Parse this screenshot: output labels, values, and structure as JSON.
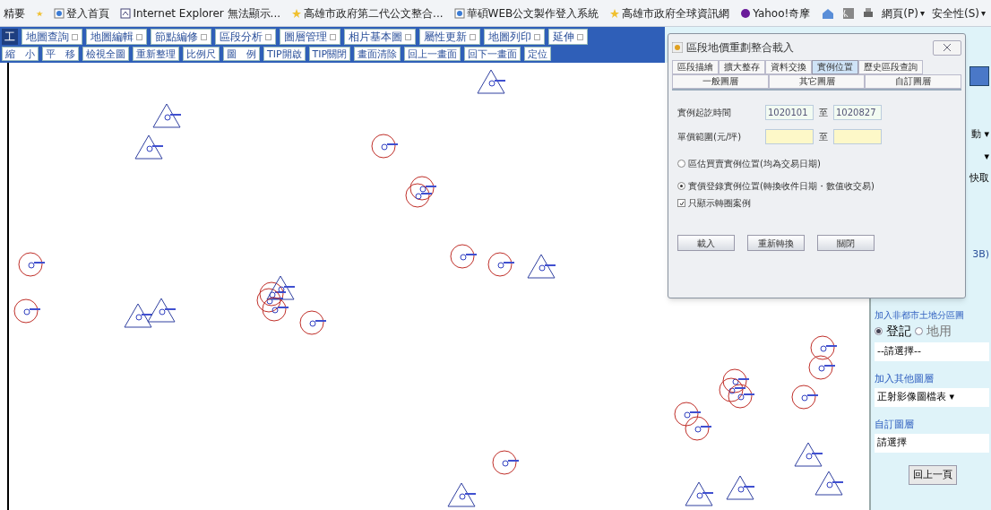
{
  "favorites_bar": {
    "items": [
      {
        "label": "精要",
        "kind": "text"
      },
      {
        "label": "登入首頁",
        "kind": "page"
      },
      {
        "label": "Internet Explorer 無法顯示...",
        "kind": "error"
      },
      {
        "label": "高雄市政府第二代公文整合...",
        "kind": "star"
      },
      {
        "label": "華碩WEB公文製作登入系統",
        "kind": "page"
      },
      {
        "label": "高雄市政府全球資訊網",
        "kind": "star"
      },
      {
        "label": "Yahoo!奇摩",
        "kind": "yahoo"
      }
    ],
    "commands": [
      {
        "label": "網頁(P)",
        "caret": "▾"
      },
      {
        "label": "安全性(S)",
        "caret": "▾"
      }
    ]
  },
  "menu_bar": {
    "title": "工",
    "items": [
      "地圖查詢",
      "地圖編輯",
      "節點編修",
      "區段分析",
      "圖層管理",
      "相片基本圖",
      "屬性更新",
      "地圖列印",
      "延伸"
    ]
  },
  "tool_bar": {
    "items": [
      "縮　小",
      "平　移",
      "檢視全圖",
      "重新整理",
      "比例尺",
      "圖　例",
      "TIP開啟",
      "TIP關閉",
      "畫面清除",
      "回上一畫面",
      "回下一畫面",
      "定位"
    ]
  },
  "dialog": {
    "title": "區段地價重劃整合載入",
    "tabs": [
      {
        "label": "區段描繪",
        "selected": false
      },
      {
        "label": "擴大整存",
        "selected": false
      },
      {
        "label": "資料交換",
        "selected": false
      },
      {
        "label": "實例位置",
        "selected": true
      },
      {
        "label": "歷史區段查詢",
        "selected": false
      }
    ],
    "sub_tabs": [
      "一般圖層",
      "其它圖層",
      "自訂圖層"
    ],
    "date_range": {
      "label": "實例起訖時間",
      "from": "1020101",
      "sep": "至",
      "to": "1020827"
    },
    "price_range": {
      "label": "單價範圍(元/坪)",
      "sep": "至"
    },
    "radios": [
      {
        "label": "區估買賣實例位置(均為交易日期)",
        "selected": false
      },
      {
        "label": "實價登錄實例位置(轉換收件日期・數值收交易)",
        "selected": true
      }
    ],
    "checkbox": {
      "label": "只顯示轉圈案例",
      "checked": true
    },
    "buttons": [
      "載入",
      "重新轉換",
      "關閉"
    ]
  },
  "side_panel": {
    "hidden_texts": [
      "動 ▾",
      "▾",
      "快取",
      "3B)"
    ],
    "land_zone": {
      "title": "加入非都市土地分區圖",
      "radios": [
        {
          "label": "登記",
          "selected": true
        },
        {
          "label": "地用",
          "selected": false
        }
      ],
      "select": "--請選擇--"
    },
    "other_layers": {
      "title": "加入其他圖層",
      "select": "正射影像圖檔表 ▾"
    },
    "custom_layers": {
      "title": "自訂圖層",
      "select": "請選擇"
    },
    "back_button": "回上一頁"
  }
}
